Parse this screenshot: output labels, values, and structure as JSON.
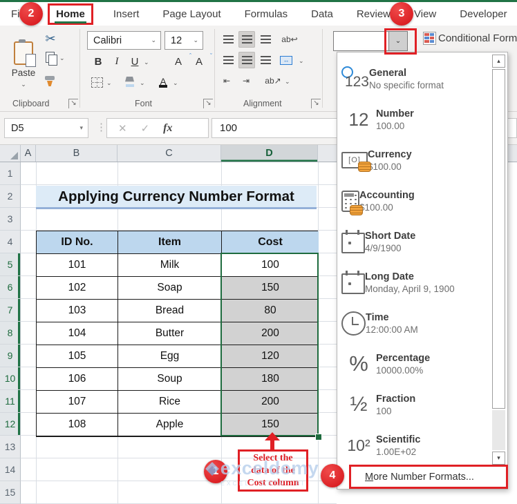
{
  "tabs": {
    "items": [
      {
        "label": "File",
        "active": false
      },
      {
        "label": "Home",
        "active": true
      },
      {
        "label": "Insert",
        "active": false
      },
      {
        "label": "Page Layout",
        "active": false
      },
      {
        "label": "Formulas",
        "active": false
      },
      {
        "label": "Data",
        "active": false
      },
      {
        "label": "Review",
        "active": false
      },
      {
        "label": "View",
        "active": false
      },
      {
        "label": "Developer",
        "active": false
      }
    ]
  },
  "ribbon": {
    "clipboard": {
      "label": "Clipboard",
      "paste_label": "Paste"
    },
    "font": {
      "label": "Font",
      "font_name": "Calibri",
      "font_size": "12",
      "bold": "B",
      "italic": "I",
      "underline": "U",
      "grow": "A",
      "shrink": "A",
      "font_color": "A"
    },
    "alignment": {
      "label": "Alignment",
      "wrap_glyph": "ab↩",
      "merge_glyph": "↔",
      "indent_left": "⇤",
      "indent_right": "⇥",
      "orientation_glyph": "ab↗"
    },
    "number_format_value": "",
    "conditional_formatting_label": "Conditional Form"
  },
  "icons": {
    "chevron_down": "⌄",
    "dropdown_arrow": "▾",
    "scroll_up": "▴",
    "scroll_down": "▾",
    "cancel": "✕",
    "check": "✓",
    "fx": "fx",
    "dots": "⋮",
    "launcher": "↘",
    "scissors": "✂"
  },
  "formula_bar": {
    "name_box": "D5",
    "value": "100"
  },
  "grid": {
    "columns": [
      "A",
      "B",
      "C",
      "D"
    ],
    "selected_column": "D",
    "rows": [
      "1",
      "2",
      "3",
      "4",
      "5",
      "6",
      "7",
      "8",
      "9",
      "10",
      "11",
      "12",
      "13",
      "14",
      "15"
    ],
    "selected_rows": [
      "5",
      "6",
      "7",
      "8",
      "9",
      "10",
      "11",
      "12"
    ]
  },
  "sheet": {
    "title": "Applying Currency Number Format",
    "table": {
      "headers": [
        "ID No.",
        "Item",
        "Cost"
      ],
      "rows": [
        [
          "101",
          "Milk",
          "100"
        ],
        [
          "102",
          "Soap",
          "150"
        ],
        [
          "103",
          "Bread",
          "80"
        ],
        [
          "104",
          "Butter",
          "200"
        ],
        [
          "105",
          "Egg",
          "120"
        ],
        [
          "106",
          "Soup",
          "180"
        ],
        [
          "107",
          "Rice",
          "200"
        ],
        [
          "108",
          "Apple",
          "150"
        ]
      ]
    }
  },
  "format_dropdown": {
    "items": [
      {
        "label": "General",
        "example": "No specific format",
        "icon": "icon-clock-123-icon"
      },
      {
        "label": "Number",
        "example": "100.00",
        "icon": "icon-number-12-icon"
      },
      {
        "label": "Currency",
        "example": "$100.00",
        "icon": "icon-banknote-coins-icon"
      },
      {
        "label": "Accounting",
        "example": "$100.00",
        "icon": "icon-calculator-coins-icon"
      },
      {
        "label": "Short Date",
        "example": "4/9/1900",
        "icon": "icon-calendar-icon"
      },
      {
        "label": "Long Date",
        "example": "Monday, April 9, 1900",
        "icon": "icon-calendar-icon"
      },
      {
        "label": "Time",
        "example": "12:00:00 AM",
        "icon": "icon-clock-icon"
      },
      {
        "label": "Percentage",
        "example": "10000.00%",
        "icon": "icon-percent-icon"
      },
      {
        "label": "Fraction",
        "example": "100",
        "icon": "icon-fraction-icon"
      },
      {
        "label": "Scientific",
        "example": "1.00E+02",
        "icon": "icon-scientific-icon"
      }
    ],
    "more_accel": "M",
    "more_rest": "ore Number Formats..."
  },
  "annotations": {
    "step1": "1",
    "step2": "2",
    "step3": "3",
    "step4": "4",
    "callout_lines": [
      "Select the",
      "data of the",
      "Cost column"
    ]
  },
  "watermark": {
    "brand": "exceldemy",
    "tagline": "EXCEL · DATA · BI"
  },
  "colors": {
    "excel_green": "#217346",
    "annotation_red": "#e02025",
    "table_header_fill": "#BDD7EE",
    "title_fill": "#DDEBF7",
    "selected_cell_fill": "#d2d2d2"
  }
}
